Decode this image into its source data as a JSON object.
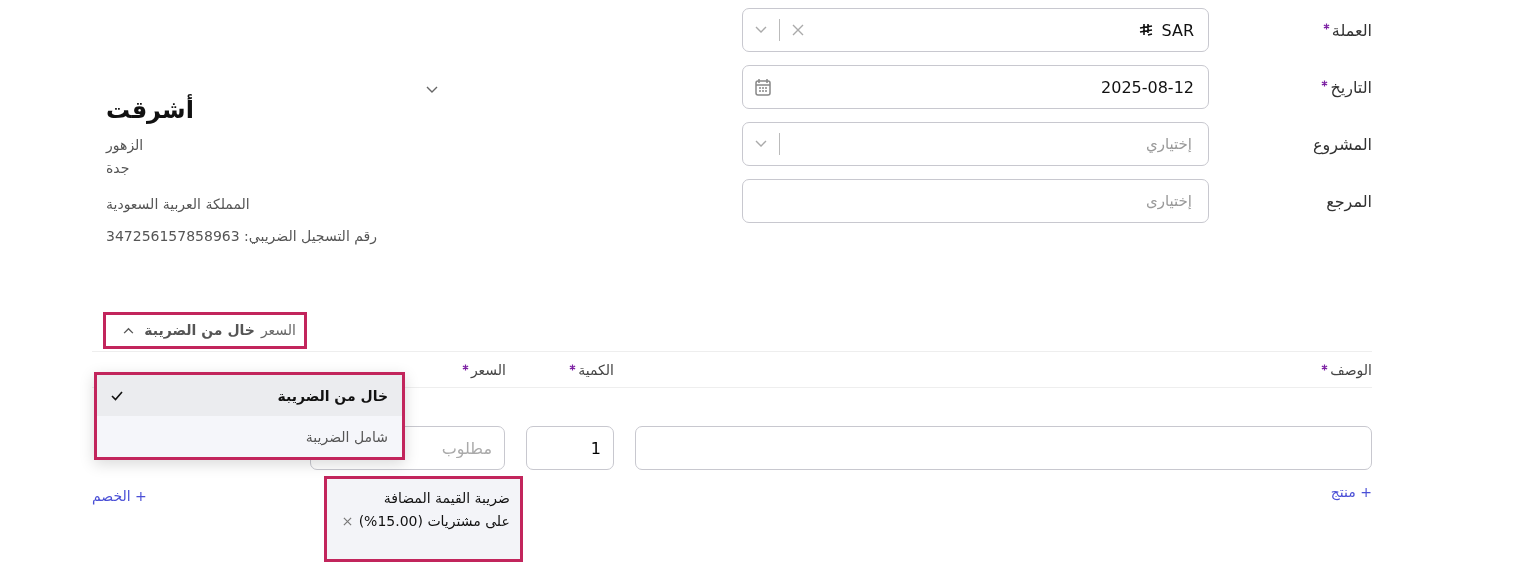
{
  "form": [
    {
      "label": "العملة",
      "required": true,
      "kind": "select",
      "value": "SAR",
      "currency_sign": true,
      "clearable": true
    },
    {
      "label": "التاريخ",
      "required": true,
      "kind": "date",
      "value": "2025-08-12"
    },
    {
      "label": "المشروع",
      "required": false,
      "kind": "select",
      "placeholder": "إختياري"
    },
    {
      "label": "المرجع",
      "required": false,
      "kind": "text",
      "placeholder": "إختيارى"
    }
  ],
  "company": {
    "name": "أشرقت",
    "address_lines": [
      "الزهور",
      "جدة"
    ],
    "country": "المملكة العربية السعودية",
    "tax_number": "رقم التسجيل الضريبي: 347256157858963"
  },
  "price_mode": {
    "label": "السعر",
    "value": "خال من الضريبة",
    "expanded": true,
    "highlighted": true
  },
  "columns": [
    {
      "label": "الوصف",
      "required": true
    },
    {
      "label": "الكمية",
      "required": true
    },
    {
      "label": "السعر",
      "required": true
    }
  ],
  "line_item": {
    "quantity": "1",
    "price_placeholder": "مطلوب"
  },
  "add_product": "+ منتج",
  "add_discount": "+ الخصم",
  "tax_chip": {
    "label": "ضريبة القيمة المضافة على مشتريات (15.00%)",
    "highlighted": true
  },
  "menu": {
    "highlighted": true,
    "options": [
      {
        "label": "خال من الضريبة",
        "selected": true
      },
      {
        "label": "شامل الضريبة",
        "selected": false
      }
    ]
  }
}
